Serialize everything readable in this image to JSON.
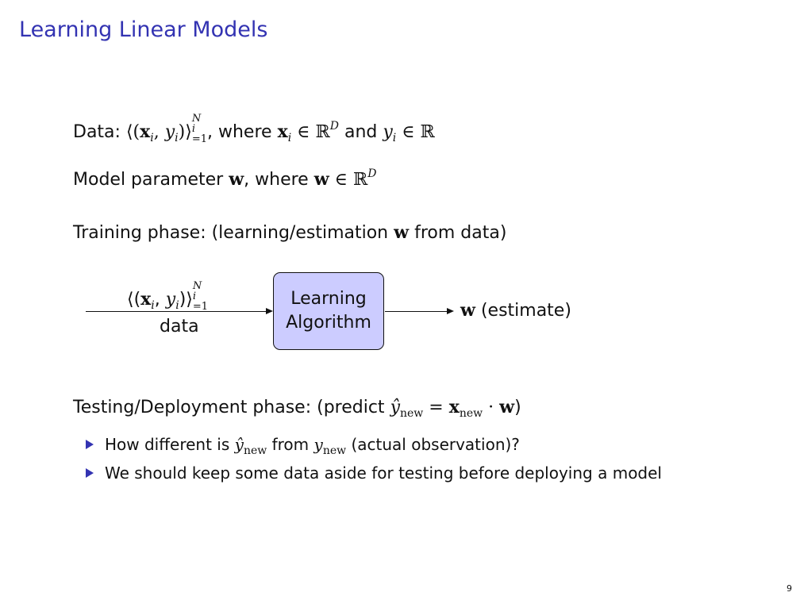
{
  "slide": {
    "title": "Learning Linear Models",
    "page_number": "9"
  },
  "data_line": {
    "label": "Data:",
    "where": ", where",
    "and": "and"
  },
  "model_line": {
    "text": "Model parameter",
    "where": ", where"
  },
  "training_line": {
    "before": "Training phase: (learning/estimation",
    "after": "from data)"
  },
  "diagram": {
    "input_caption": "data",
    "box_line1": "Learning",
    "box_line2": "Algorithm",
    "output_caption": "(estimate)"
  },
  "testing_line": {
    "before": "Testing/Deployment phase: (predict",
    "after": ")"
  },
  "bullets": [
    {
      "before": "How different is",
      "middle": "from",
      "after": "(actual observation)?"
    },
    {
      "text": "We should keep some data aside for testing before deploying a model"
    }
  ],
  "colors": {
    "title": "#3333b2",
    "box_fill": "#ccccff",
    "bullet": "#3333b2"
  }
}
